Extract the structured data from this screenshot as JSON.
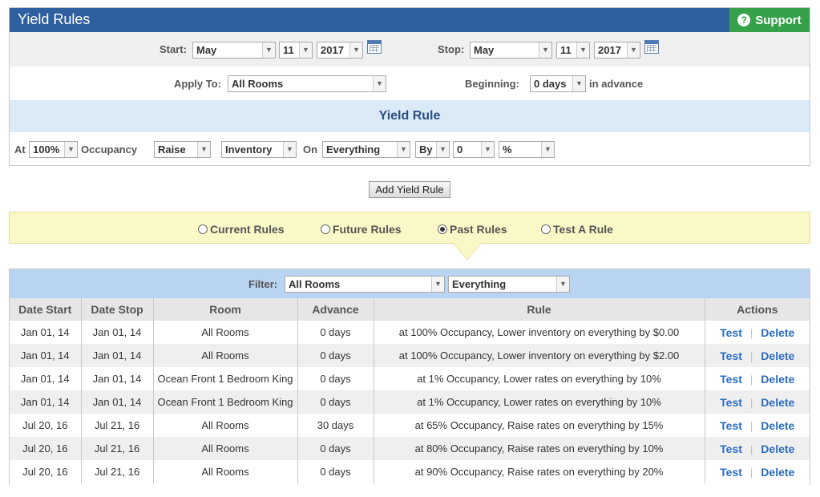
{
  "header": {
    "title": "Yield Rules",
    "support_label": "Support"
  },
  "dates": {
    "start_label": "Start:",
    "start_month": "May",
    "start_day": "11",
    "start_year": "2017",
    "stop_label": "Stop:",
    "stop_month": "May",
    "stop_day": "11",
    "stop_year": "2017"
  },
  "apply": {
    "apply_label": "Apply To:",
    "apply_value": "All Rooms",
    "beginning_label": "Beginning:",
    "beginning_value": "0 days",
    "suffix": "in advance"
  },
  "yield_rule": {
    "heading": "Yield Rule",
    "at_label": "At",
    "occupancy_value": "100%",
    "occupancy_label": "Occupancy",
    "action_value": "Raise",
    "target_value": "Inventory",
    "on_label": "On",
    "scope_value": "Everything",
    "by_value": "By",
    "amount_value": "0",
    "unit_value": "%"
  },
  "add_button": "Add Yield Rule",
  "tabs": [
    {
      "label": "Current Rules",
      "selected": false
    },
    {
      "label": "Future Rules",
      "selected": false
    },
    {
      "label": "Past Rules",
      "selected": true
    },
    {
      "label": "Test A Rule",
      "selected": false
    }
  ],
  "filter": {
    "label": "Filter:",
    "room_value": "All Rooms",
    "scope_value": "Everything"
  },
  "table": {
    "columns": [
      "Date Start",
      "Date Stop",
      "Room",
      "Advance",
      "Rule",
      "Actions"
    ],
    "rows": [
      {
        "start": "Jan 01, 14",
        "stop": "Jan 01, 14",
        "room": "All Rooms",
        "advance": "0 days",
        "rule": "at 100% Occupancy, Lower inventory on everything by $0.00"
      },
      {
        "start": "Jan 01, 14",
        "stop": "Jan 01, 14",
        "room": "All Rooms",
        "advance": "0 days",
        "rule": "at 100% Occupancy, Lower inventory on everything by $2.00"
      },
      {
        "start": "Jan 01, 14",
        "stop": "Jan 01, 14",
        "room": "Ocean Front 1 Bedroom King",
        "advance": "0 days",
        "rule": "at 1% Occupancy, Lower rates on everything by 10%"
      },
      {
        "start": "Jan 01, 14",
        "stop": "Jan 01, 14",
        "room": "Ocean Front 1 Bedroom King",
        "advance": "0 days",
        "rule": "at 1% Occupancy, Lower rates on everything by 10%"
      },
      {
        "start": "Jul 20, 16",
        "stop": "Jul 21, 16",
        "room": "All Rooms",
        "advance": "30 days",
        "rule": "at 65% Occupancy, Raise rates on everything by 15%"
      },
      {
        "start": "Jul 20, 16",
        "stop": "Jul 21, 16",
        "room": "All Rooms",
        "advance": "0 days",
        "rule": "at 80% Occupancy, Raise rates on everything by 10%"
      },
      {
        "start": "Jul 20, 16",
        "stop": "Jul 21, 16",
        "room": "All Rooms",
        "advance": "0 days",
        "rule": "at 90% Occupancy, Raise rates on everything by 20%"
      }
    ],
    "action_test": "Test",
    "action_delete": "Delete"
  }
}
